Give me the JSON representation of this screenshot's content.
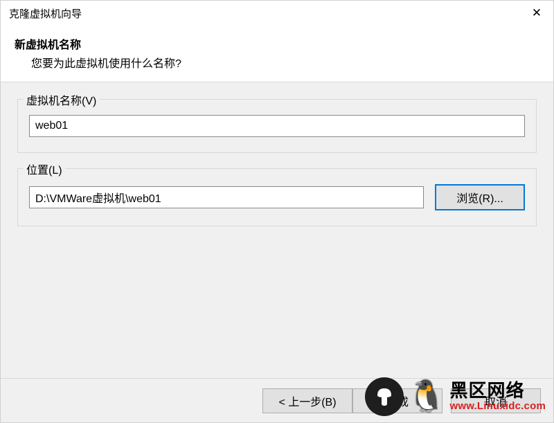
{
  "window": {
    "title": "克隆虚拟机向导"
  },
  "header": {
    "title": "新虚拟机名称",
    "subtitle": "您要为此虚拟机使用什么名称?"
  },
  "nameGroup": {
    "label": "虚拟机名称(V)",
    "value": "web01"
  },
  "locationGroup": {
    "label": "位置(L)",
    "value": "D:\\VMWare虚拟机\\web01",
    "browse": "浏览(R)..."
  },
  "footer": {
    "back": "< 上一步(B)",
    "finish": "完成",
    "cancel": "取消"
  },
  "watermark": {
    "cn": "黑区网络",
    "url": "www.Linuxidc.com"
  }
}
